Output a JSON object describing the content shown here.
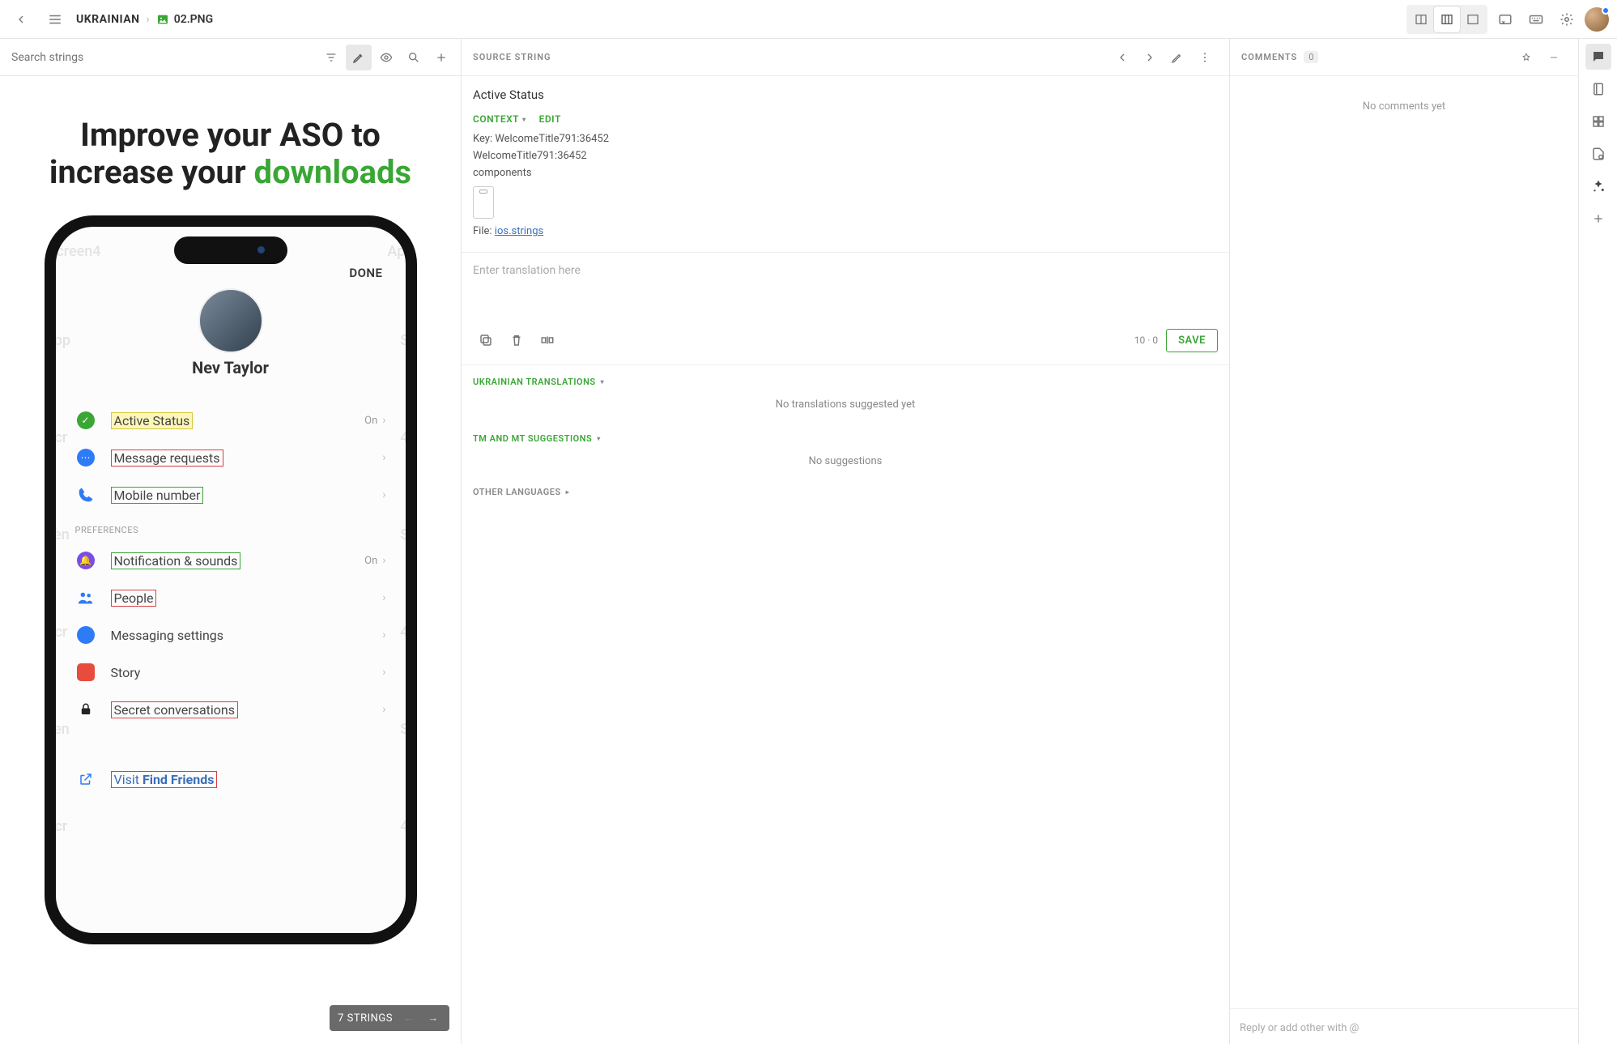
{
  "topbar": {
    "language": "UKRAINIAN",
    "file": "02.PNG"
  },
  "leftPanel": {
    "searchPlaceholder": "Search strings",
    "stringsBadge": "7 STRINGS"
  },
  "preview": {
    "headline1": "Improve your ASO to",
    "headline2pre": "increase your ",
    "headline2green": "downloads",
    "done": "DONE",
    "profileName": "Nev Taylor",
    "items": {
      "activeStatus": "Active Status",
      "messageRequests": "Message requests",
      "mobileNumber": "Mobile number",
      "preferences": "PREFERENCES",
      "notificationSounds": "Notification & sounds",
      "people": "People",
      "messagingSettings": "Messaging settings",
      "story": "Story",
      "secretConversations": "Secret conversations",
      "visitPrefix": "Visit ",
      "visitLink": "Find Friends",
      "on": "On"
    }
  },
  "mid": {
    "headerTitle": "SOURCE STRING",
    "sourceString": "Active Status",
    "contextLabel": "CONTEXT",
    "editLabel": "EDIT",
    "keyLine": "Key: WelcomeTitle791:36452",
    "keyLine2": "WelcomeTitle791:36452",
    "keyLine3": "components",
    "filePrefix": "File: ",
    "fileLink": "ios.strings",
    "translationPlaceholder": "Enter translation here",
    "counter": "10 · 0",
    "saveLabel": "SAVE",
    "translationsHead": "UKRAINIAN TRANSLATIONS",
    "noTranslations": "No translations suggested yet",
    "tmHead": "TM AND MT SUGGESTIONS",
    "noSuggestions": "No suggestions",
    "otherLang": "OTHER LANGUAGES"
  },
  "right": {
    "title": "COMMENTS",
    "count": "0",
    "noComments": "No comments yet",
    "replyPlaceholder": "Reply or add other with @"
  }
}
